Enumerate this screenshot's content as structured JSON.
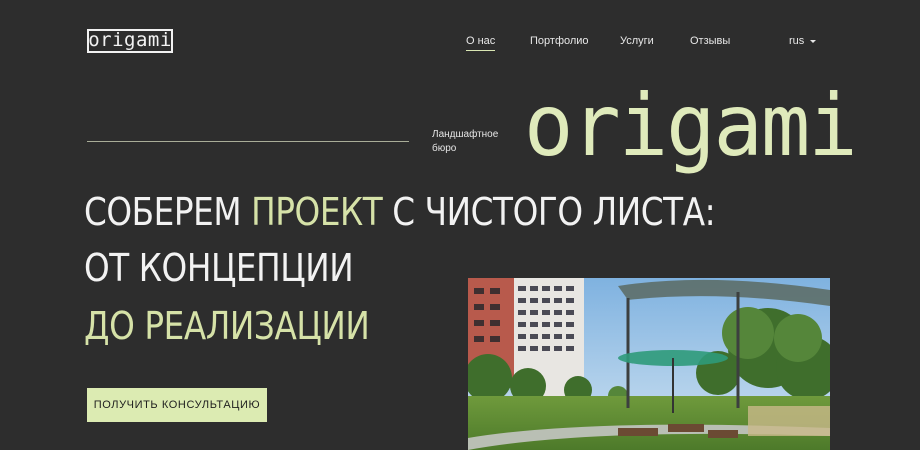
{
  "header": {
    "logo_text": "origami",
    "nav": [
      {
        "label": "О нас",
        "active": true
      },
      {
        "label": "Портфолио",
        "active": false
      },
      {
        "label": "Услуги",
        "active": false
      },
      {
        "label": "Отзывы",
        "active": false
      }
    ],
    "language": "rus"
  },
  "hero": {
    "tagline_line1": "Ландшафтное",
    "tagline_line2": "бюро",
    "brand_big": "origami",
    "headline": {
      "line1_part1": "СОБЕРЕМ ",
      "line1_accent": "ПРОЕКТ",
      "line1_part2": " С ЧИСТОГО ЛИСТА:",
      "line2": "ОТ КОНЦЕПЦИИ",
      "line3": "ДО РЕАЛИЗАЦИИ"
    },
    "cta_label": "ПОЛУЧИТЬ КОНСУЛЬТАЦИЮ"
  },
  "colors": {
    "background": "#2d2d2d",
    "accent": "#d6e2a8",
    "button_bg": "#dcebb2"
  }
}
